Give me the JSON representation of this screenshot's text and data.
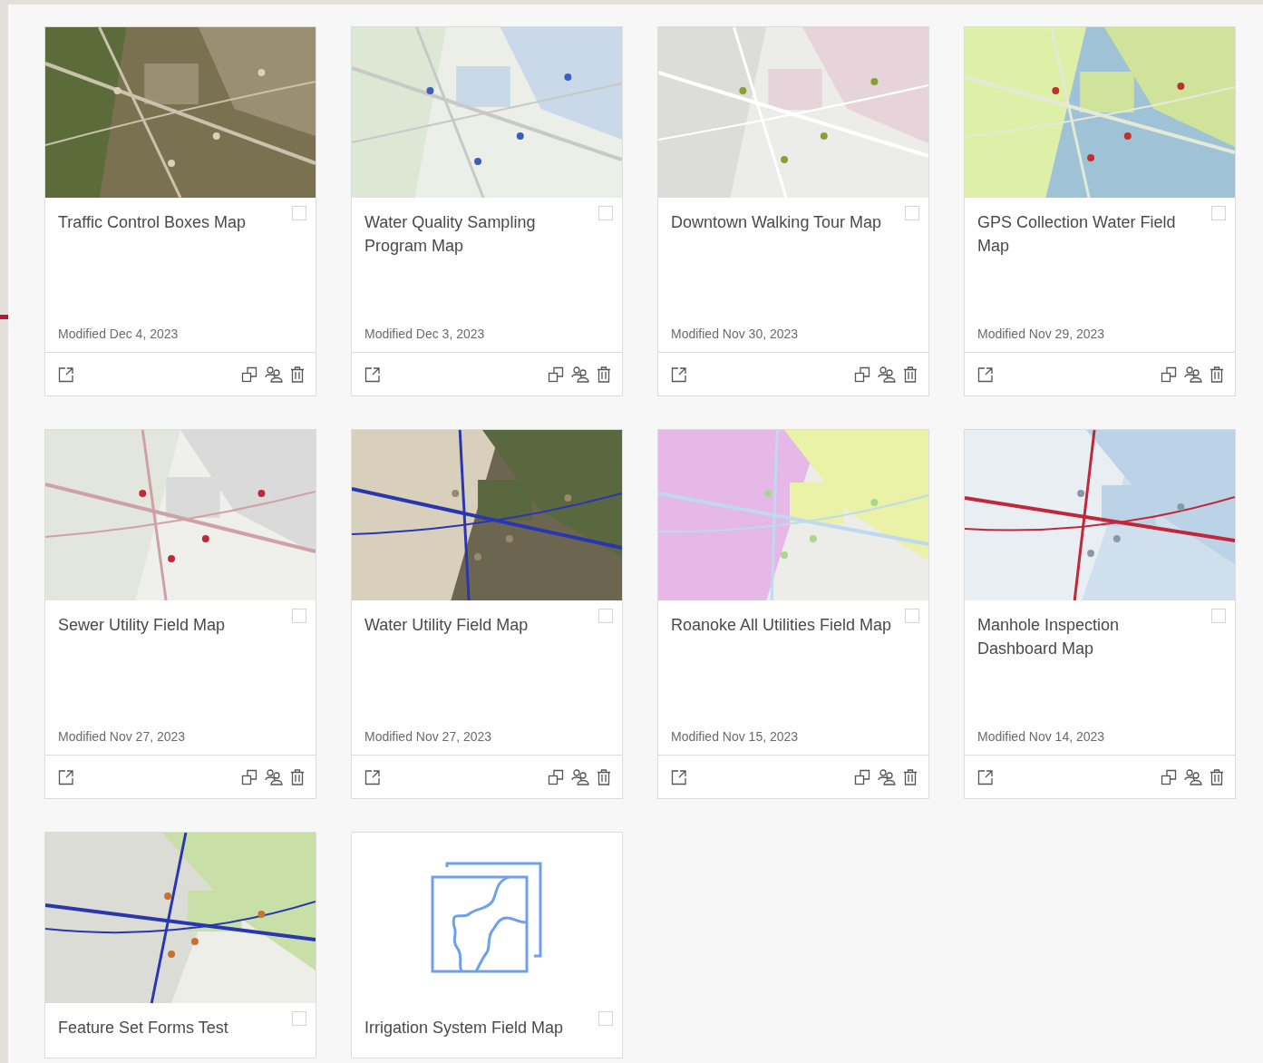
{
  "cards": [
    {
      "title": "Traffic Control Boxes Map",
      "selected": false,
      "modified": "Modified Dec 4, 2023",
      "actions": true
    },
    {
      "title": "Water Quality Sampling Program Map",
      "selected": false,
      "modified": "Modified Dec 3, 2023",
      "actions": true
    },
    {
      "title": "Downtown Walking Tour Map",
      "selected": false,
      "modified": "Modified Nov 30, 2023",
      "actions": true
    },
    {
      "title": "GPS Collection Water Field Map",
      "selected": false,
      "modified": "Modified Nov 29, 2023",
      "actions": true
    },
    {
      "title": "Sewer Utility Field Map",
      "selected": false,
      "modified": "Modified Nov 27, 2023",
      "actions": true
    },
    {
      "title": "Water Utility Field Map",
      "selected": false,
      "modified": "Modified Nov 27, 2023",
      "actions": true
    },
    {
      "title": "Roanoke All Utilities Field Map",
      "selected": false,
      "modified": "Modified Nov 15, 2023",
      "actions": true
    },
    {
      "title": "Manhole Inspection Dashboard Map",
      "selected": false,
      "modified": "Modified Nov 14, 2023",
      "actions": true
    },
    {
      "title": "Feature Set Forms Test",
      "selected": false
    },
    {
      "title": "Irrigation System Field Map",
      "thumbnail": {
        "kind": "placeholder"
      },
      "selected": false
    }
  ]
}
